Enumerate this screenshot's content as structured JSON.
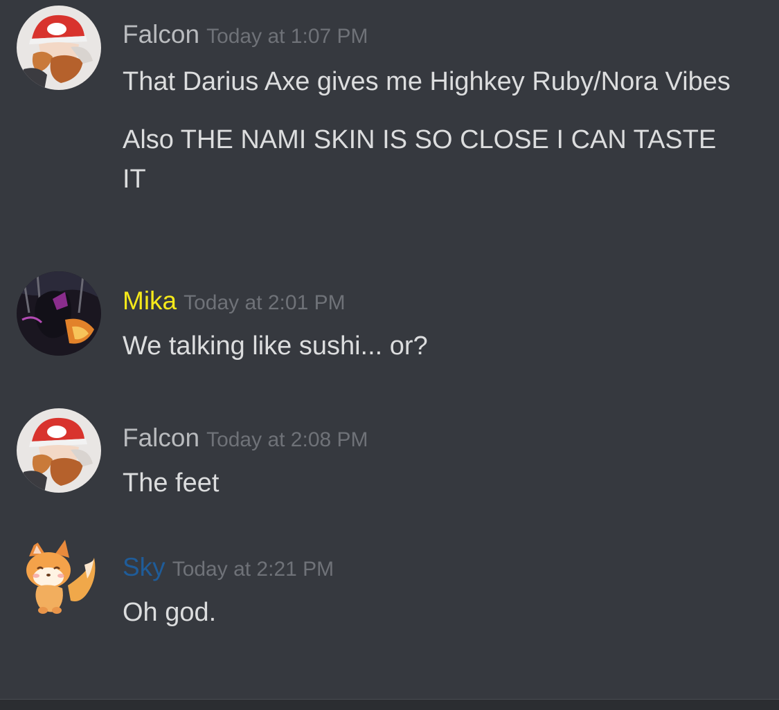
{
  "messages": [
    {
      "username": "Falcon",
      "username_color": "#b9bbbe",
      "timestamp": "Today at 1:07 PM",
      "avatar_icon": "trainer-red-cap-avatar",
      "lines": [
        "That Darius Axe gives me Highkey Ruby/Nora Vibes",
        "Also THE NAMI SKIN IS SO CLOSE I CAN TASTE IT"
      ]
    },
    {
      "username": "Mika",
      "username_color": "#f5e91a",
      "timestamp": "Today at 2:01 PM",
      "avatar_icon": "dark-warrior-avatar",
      "lines": [
        "We talking like sushi... or?"
      ]
    },
    {
      "username": "Falcon",
      "username_color": "#b9bbbe",
      "timestamp": "Today at 2:08 PM",
      "avatar_icon": "trainer-red-cap-avatar",
      "lines": [
        "The feet"
      ]
    },
    {
      "username": "Sky",
      "username_color": "#1f5c99",
      "timestamp": "Today at 2:21 PM",
      "avatar_icon": "fox-avatar",
      "lines": [
        "Oh god."
      ]
    }
  ]
}
